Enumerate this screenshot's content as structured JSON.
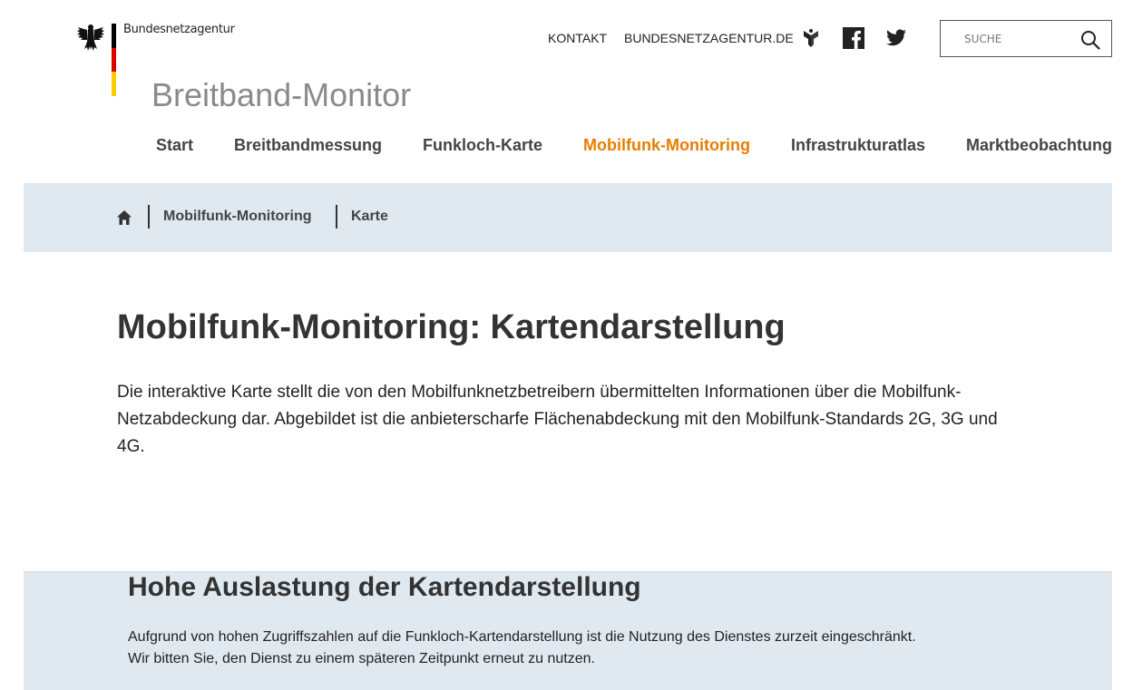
{
  "header": {
    "agency_name": "Bundesnetzagentur",
    "site_title": "Breitband-Monitor",
    "top_links": {
      "kontakt": "KONTAKT",
      "bundesnetzagentur": "BUNDESNETZAGENTUR.DE"
    },
    "social_icons": [
      "mastodon-icon",
      "facebook-icon",
      "twitter-icon"
    ],
    "search": {
      "placeholder": "SUCHE"
    }
  },
  "main_nav": {
    "items": [
      {
        "label": "Start"
      },
      {
        "label": "Breitbandmessung"
      },
      {
        "label": "Funkloch-Karte"
      },
      {
        "label": "Mobilfunk-Monitoring"
      },
      {
        "label": "Infrastrukturatlas"
      },
      {
        "label": "Marktbeobachtung"
      }
    ],
    "active": "Mobilfunk-Monitoring"
  },
  "breadcrumb": {
    "home_icon": "home-icon",
    "items": [
      {
        "label": "Mobilfunk-Monitoring"
      },
      {
        "label": "Karte"
      }
    ]
  },
  "content": {
    "title": "Mobilfunk-Monitoring: Kartendarstellung",
    "intro": "Die interaktive Karte stellt die von den Mobilfunknetzbetreibern übermittelten Informationen über die Mobilfunk-Netzabdeckung dar. Abgebildet ist die anbieterscharfe Flächenabdeckung mit den Mobilfunk-Standards 2G, 3G und 4G."
  },
  "notice": {
    "title": "Hohe Auslastung der Kartendarstellung",
    "line1": "Aufgrund von hohen Zugriffszahlen auf die Funkloch-Kartendarstellung ist die Nutzung des Dienstes zurzeit eingeschränkt.",
    "line2": "Wir bitten Sie, den Dienst zu einem späteren Zeitpunkt erneut zu nutzen."
  },
  "colors": {
    "accent": "#e87d00",
    "band_background": "#e1e9f0",
    "site_title": "#8a8a8a",
    "flag_black": "#000000",
    "flag_red": "#dd0000",
    "flag_gold": "#ffcc00"
  }
}
